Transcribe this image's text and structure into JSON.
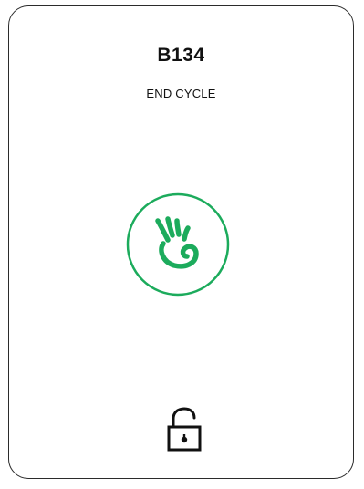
{
  "locker": {
    "id": "B134",
    "status": "END CYCLE"
  },
  "icons": {
    "tap": "hand-wave-icon",
    "lock": "unlocked-padlock-icon"
  },
  "colors": {
    "accent": "#1cab5c",
    "text": "#111111",
    "border": "#2b2b2b"
  }
}
